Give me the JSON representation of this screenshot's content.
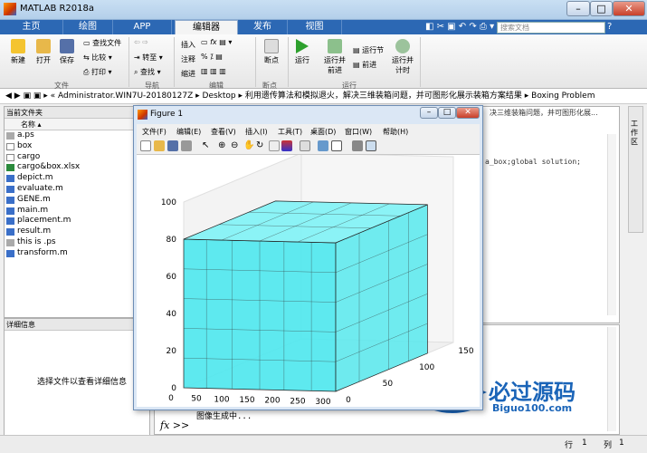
{
  "window": {
    "title": "MATLAB R2018a"
  },
  "tabs": [
    "主页",
    "绘图",
    "APP",
    "编辑器",
    "发布",
    "视图"
  ],
  "search": {
    "placeholder": "搜索文档"
  },
  "ribbon": {
    "file": {
      "new": "新建",
      "open": "打开",
      "save": "保存",
      "find_files": "查找文件",
      "compare": "比较",
      "print": "打印",
      "group": "文件"
    },
    "nav": {
      "goto": "转至",
      "find": "查找",
      "group": "导航"
    },
    "edit": {
      "insert": "插入",
      "comment": "注释",
      "indent": "缩进",
      "group": "编辑"
    },
    "breakpoints": {
      "label": "断点",
      "group": "断点"
    },
    "run": {
      "run": "运行",
      "run_advance": "运行并\n前进",
      "run_section": "运行节",
      "advance": "前进",
      "run_time": "运行并\n计时",
      "group": "运行"
    }
  },
  "address": {
    "path": [
      "Administrator.WIN7U-20180127Z",
      "Desktop",
      "利用遗传算法和模拟退火，解决三维装箱问题，并可图形化展示装箱方案结果",
      "Boxing Problem"
    ]
  },
  "current_folder": {
    "title": "当前文件夹",
    "column": "名称",
    "files": [
      "a.ps",
      "box",
      "cargo",
      "cargo&box.xlsx",
      "depict.m",
      "evaluate.m",
      "GENE.m",
      "main.m",
      "placement.m",
      "result.m",
      "this is .ps",
      "transform.m"
    ]
  },
  "details": {
    "title": "详细信息",
    "hint": "选择文件以查看详细信息"
  },
  "editor": {
    "code_fragment": "a_box;global solution;",
    "tab_fragment": "决三维装箱问题，并可图形化展..."
  },
  "command": {
    "progress_text": "图像生成中...",
    "prompt": "fx >>"
  },
  "right_strip": {
    "label": "工作区"
  },
  "status": {
    "line_label": "行",
    "line": "1",
    "col_label": "列",
    "col": "1"
  },
  "figure": {
    "title": "Figure 1",
    "menu": [
      "文件(F)",
      "编辑(E)",
      "查看(V)",
      "插入(I)",
      "工具(T)",
      "桌面(D)",
      "窗口(W)",
      "帮助(H)"
    ]
  },
  "watermark": {
    "text": "必过源码",
    "url": "Biguo100.com"
  },
  "chart_data": {
    "type": "3d-box",
    "z_ticks": [
      "0",
      "20",
      "40",
      "60",
      "80",
      "100"
    ],
    "x_ticks": [
      "0",
      "50",
      "100",
      "150",
      "200",
      "250",
      "300"
    ],
    "y_ticks": [
      "0",
      "50",
      "100",
      "150"
    ],
    "box_color": "#4ee8ee"
  }
}
